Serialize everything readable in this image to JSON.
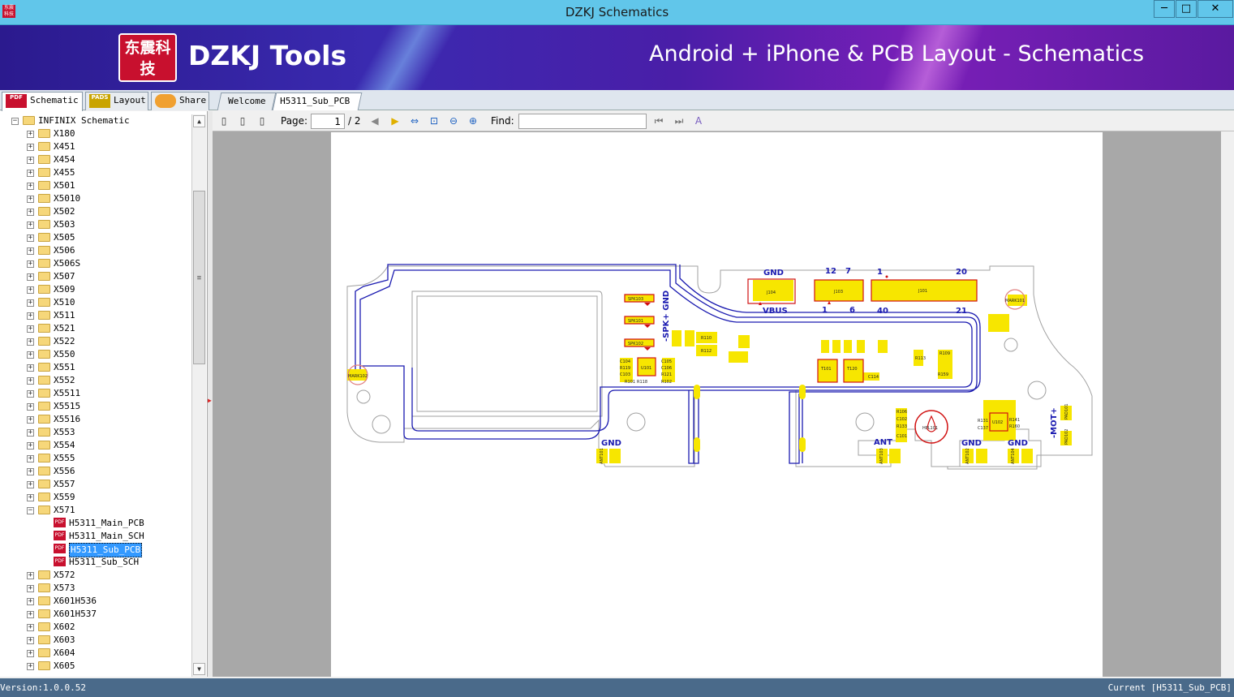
{
  "window": {
    "title": "DZKJ Schematics",
    "icon_text": "东震科技",
    "minimize": "─",
    "maximize": "□",
    "close": "✕"
  },
  "banner": {
    "logo_text": "东震科技",
    "brand": "DZKJ Tools",
    "tagline": "Android + iPhone & PCB Layout - Schematics"
  },
  "left_tabs": [
    {
      "label": "Schematic",
      "icon": "PDF"
    },
    {
      "label": "Layout",
      "icon": "PADS"
    },
    {
      "label": "Share",
      "icon": "cloud"
    }
  ],
  "doc_tabs": [
    {
      "label": "Welcome"
    },
    {
      "label": "H5311_Sub_PCB",
      "close": "✕"
    }
  ],
  "tree": {
    "root": "INFINIX Schematic",
    "folders_before": [
      "X180",
      "X451",
      "X454",
      "X455",
      "X501",
      "X5010",
      "X502",
      "X503",
      "X505",
      "X506",
      "X506S",
      "X507",
      "X509",
      "X510",
      "X511",
      "X521",
      "X522",
      "X550",
      "X551",
      "X552",
      "X5511",
      "X5515",
      "X5516",
      "X553",
      "X554",
      "X555",
      "X556",
      "X557",
      "X559"
    ],
    "expanded_folder": "X571",
    "files": [
      "H5311_Main_PCB",
      "H5311_Main_SCH",
      "H5311_Sub_PCB",
      "H5311_Sub_SCH"
    ],
    "selected_file": "H5311_Sub_PCB",
    "folders_after": [
      "X572",
      "X573",
      "X601H536",
      "X601H537",
      "X602",
      "X603",
      "X604",
      "X605"
    ]
  },
  "toolbar": {
    "page_label": "Page:",
    "page_value": "1",
    "page_total": "/ 2",
    "find_label": "Find:",
    "find_value": ""
  },
  "pcb_labels": {
    "gnd": "GND",
    "vbus": "VBUS",
    "ant": "ANT",
    "spk": "-SPK+ GND",
    "mot": "-MOT+",
    "n12": "12",
    "n7": "7",
    "n1a": "1",
    "n20": "20",
    "n1b": "1",
    "n6": "6",
    "n40": "40",
    "n21": "21",
    "j104": "J104",
    "j103": "J103",
    "j101": "J101",
    "mark101": "MARK101",
    "mark102": "MARK102",
    "u101": "U101",
    "u102": "U102",
    "t101": "T101",
    "t120": "T120",
    "hpl101": "HPL101",
    "ant101": "ANT101",
    "ant102": "ANT102",
    "ant103": "ANT103",
    "ant104": "ANT104",
    "pad101": "PAD101",
    "pad102": "PAD102",
    "spk101": "SPK101",
    "spk102": "SPK102",
    "spk103": "SPK103",
    "r110": "R110",
    "r112": "R112",
    "r113": "R113",
    "r108": "R108",
    "c104": "C104",
    "r119": "R119",
    "c103": "C103",
    "r101": "R101",
    "r118": "R118",
    "c105": "C105",
    "c106": "C106",
    "r121": "R121",
    "r102": "R102",
    "c114": "C114",
    "r106": "R106",
    "c102": "C102",
    "r133": "R133",
    "c101": "C101",
    "r131": "R131",
    "c137": "C137",
    "r141": "R141",
    "r160": "R160",
    "r159": "R159",
    "r109": "R109"
  },
  "colors": {
    "trace": "#1a1ab0",
    "pad": "#f7e600",
    "refdes": "#d01010",
    "outline": "#a0a0a0"
  },
  "status": {
    "version": "Version:1.0.0.52",
    "current": "Current [H5311_Sub_PCB]"
  }
}
